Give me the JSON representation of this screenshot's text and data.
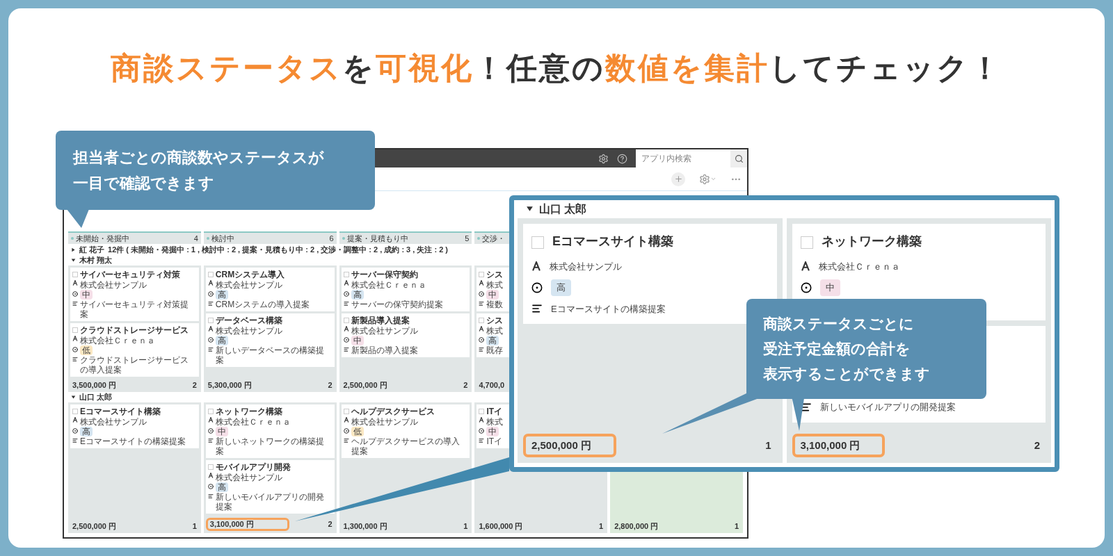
{
  "headline": [
    {
      "text": "商談ステータス",
      "highlight": true
    },
    {
      "text": "を",
      "highlight": false
    },
    {
      "text": "可視化",
      "highlight": true
    },
    {
      "text": "！任意の",
      "highlight": false
    },
    {
      "text": "数値を集計",
      "highlight": true
    },
    {
      "text": "してチェック！",
      "highlight": false
    }
  ],
  "app": {
    "search": {
      "placeholder": "アプリ内検索"
    },
    "columns": [
      {
        "label": "未開始・発掘中",
        "count": "4"
      },
      {
        "label": "検討中",
        "count": "6"
      },
      {
        "label": "提案・見積もり中",
        "count": "5"
      },
      {
        "label": "交渉・"
      }
    ],
    "collapsed_group": {
      "name": "紅 花子",
      "summary": "12件 ( 未開始・発掘中 : 1 , 検討中 : 2 , 提案・見積もり中 : 2 , 交渉・調整中 : 2 , 成約 : 3 , 失注 : 2 )",
      "expanded": false
    },
    "groups": [
      {
        "name": "木村 翔太",
        "expanded": true,
        "lanes": [
          {
            "color": "#e1e6e6",
            "total": "3,500,000 円",
            "count": "2",
            "highlighted": false,
            "cards": [
              {
                "title": "サイバーセキュリティ対策",
                "checked": false,
                "company": "株式会社サンプル",
                "priority": {
                  "label": "中",
                  "kind": "mid"
                },
                "description": "サイバーセキュリティ対策提案"
              },
              {
                "title": "クラウドストレージサービス",
                "checked": false,
                "company": "株式会社Ｃｒｅｎａ",
                "priority": {
                  "label": "低",
                  "kind": "low"
                },
                "description": "クラウドストレージサービスの導入提案"
              }
            ]
          },
          {
            "color": "#e1e6e6",
            "total": "5,300,000 円",
            "count": "2",
            "highlighted": false,
            "cards": [
              {
                "title": "CRMシステム導入",
                "checked": false,
                "company": "株式会社サンプル",
                "priority": {
                  "label": "高",
                  "kind": "high"
                },
                "description": "CRMシステムの導入提案"
              },
              {
                "title": "データベース構築",
                "checked": false,
                "company": "株式会社サンプル",
                "priority": {
                  "label": "高",
                  "kind": "high"
                },
                "description": "新しいデータベースの構築提案"
              }
            ]
          },
          {
            "color": "#e1e6e6",
            "total": "2,500,000 円",
            "count": "2",
            "highlighted": false,
            "cards": [
              {
                "title": "サーバー保守契約",
                "checked": false,
                "company": "株式会社Ｃｒｅｎａ",
                "priority": {
                  "label": "高",
                  "kind": "high"
                },
                "description": "サーバーの保守契約提案"
              },
              {
                "title": "新製品導入提案",
                "checked": false,
                "company": "株式会社サンプル",
                "priority": {
                  "label": "中",
                  "kind": "mid"
                },
                "description": "新製品の導入提案"
              }
            ]
          },
          {
            "color": "#e1e6e6",
            "total": "4,700,0",
            "highlighted": false,
            "cards": [
              {
                "title": "シス",
                "checked": false,
                "company": "株式",
                "priority": {
                  "label": "中",
                  "kind": "mid"
                },
                "description": "複数"
              },
              {
                "title": "シス",
                "checked": false,
                "company": "株式",
                "priority": {
                  "label": "高",
                  "kind": "high"
                },
                "description": "既存"
              }
            ]
          }
        ]
      },
      {
        "name": "山口 太郎",
        "expanded": true,
        "lanes": [
          {
            "color": "#e1e6e6",
            "total": "2,500,000 円",
            "count": "1",
            "highlighted": false,
            "cards": [
              {
                "title": "Eコマースサイト構築",
                "checked": false,
                "company": "株式会社サンプル",
                "priority": {
                  "label": "高",
                  "kind": "high"
                },
                "description": "Eコマースサイトの構築提案"
              }
            ]
          },
          {
            "color": "#e1e6e6",
            "total": "3,100,000 円",
            "count": "2",
            "highlighted": true,
            "cards": [
              {
                "title": "ネットワーク構築",
                "checked": false,
                "company": "株式会社Ｃｒｅｎａ",
                "priority": {
                  "label": "中",
                  "kind": "mid"
                },
                "description": "新しいネットワークの構築提案"
              },
              {
                "title": "モバイルアプリ開発",
                "checked": false,
                "company": "株式会社サンプル",
                "priority": {
                  "label": "高",
                  "kind": "high"
                },
                "description": "新しいモバイルアプリの開発提案"
              }
            ]
          },
          {
            "color": "#e1e6e6",
            "total": "1,300,000 円",
            "count": "1",
            "highlighted": false,
            "cards": [
              {
                "title": "ヘルプデスクサービス",
                "checked": false,
                "company": "株式会社サンプル",
                "priority": {
                  "label": "低",
                  "kind": "low"
                },
                "description": "ヘルプデスクサービスの導入提案"
              }
            ]
          },
          {
            "color": "#e1e6e6",
            "total": "1,600,000 円",
            "count": "1",
            "highlighted": false,
            "cards": [
              {
                "title": "ITイ",
                "checked": false,
                "company": "株式",
                "priority": {
                  "label": "中",
                  "kind": "mid"
                },
                "description": "ITイ"
              }
            ]
          },
          {
            "color": "#dcebdb",
            "total": "2,800,000 円",
            "count": "1",
            "highlighted": false
          }
        ]
      }
    ]
  },
  "zoom_panel": {
    "name": "山口 太郎",
    "expanded": true,
    "lanes": [
      {
        "color": "#e1e6e6",
        "total": "2,500,000 円",
        "count": "1",
        "highlighted": true,
        "cards": [
          {
            "title": "Eコマースサイト構築",
            "checked": false,
            "company": "株式会社サンプル",
            "priority": {
              "label": "高",
              "kind": "high"
            },
            "description": "Eコマースサイトの構築提案"
          }
        ]
      },
      {
        "color": "#e1e6e6",
        "total": "3,100,000 円",
        "count": "2",
        "highlighted": true,
        "cards": [
          {
            "title": "ネットワーク構築",
            "checked": false,
            "company": "株式会社Ｃｒｅｎａ",
            "priority": {
              "label": "中",
              "kind": "mid"
            }
          },
          {
            "description": "新しいモバイルアプリの開発提案"
          }
        ]
      }
    ]
  },
  "callouts": [
    {
      "lines": [
        "担当者ごとの商談数やステータスが",
        "一目で確認できます"
      ]
    },
    {
      "lines": [
        "商談ステータスごとに",
        "受注予定金額の合計を",
        "表示することができます"
      ]
    }
  ]
}
